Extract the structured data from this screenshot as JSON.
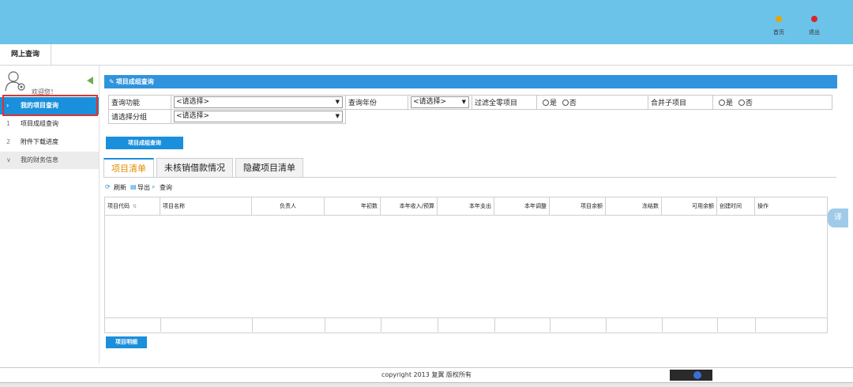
{
  "header": {
    "home_label": "首页",
    "logout_label": "退出",
    "colors": {
      "bg": "#6cc3ea",
      "home_dot": "#e2a800",
      "logout_dot": "#d8262c"
    }
  },
  "top_tab": {
    "label": "网上查询"
  },
  "sidebar": {
    "welcome": "欢迎您！",
    "items": [
      {
        "label": "我的项目查询",
        "icon": "›"
      },
      {
        "label": "项目成组查询",
        "icon": "1"
      },
      {
        "label": "附件下载进度",
        "icon": "2"
      },
      {
        "label": "我的财务信息",
        "icon": "∨"
      }
    ]
  },
  "panel": {
    "title": "项目成组查询",
    "form": {
      "func_label": "查询功能",
      "func_value": "<请选择>",
      "year_label": "查询年份",
      "year_value": "<请选择>",
      "filter_zero_label": "过滤全零项目",
      "yes": "是",
      "no": "否",
      "merge_sub_label": "合并子项目",
      "group_label": "请选择分组",
      "group_value": "<请选择>"
    },
    "query_button": "项目成组查询"
  },
  "tabs": [
    "项目清单",
    "未核销借款情况",
    "隐藏项目清单"
  ],
  "toolbar": {
    "refresh": "刷新",
    "export": "导出",
    "query": "查询"
  },
  "table": {
    "columns": [
      "项目代码",
      "项目名称",
      "负责人",
      "年初数",
      "本年收入/预算",
      "本年支出",
      "本年调整",
      "项目余额",
      "冻结数",
      "可用余额",
      "创建时间",
      "操作"
    ]
  },
  "detail_button": "项目明细",
  "footer": {
    "copyright": "copyright 2013 复翼 版权所有"
  },
  "side_tab": {
    "label": "译"
  }
}
